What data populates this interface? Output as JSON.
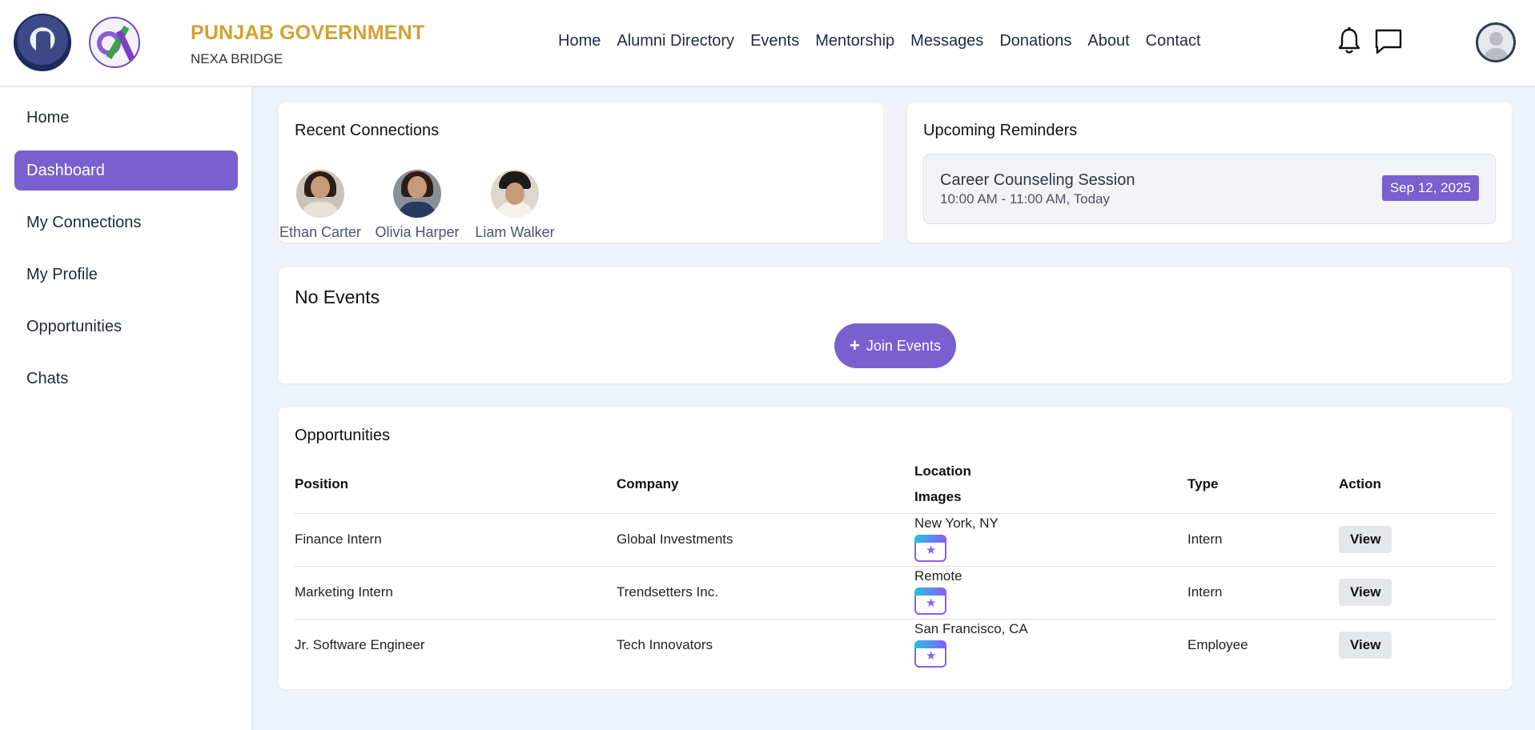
{
  "header": {
    "brand_title": "PUNJAB GOVERNMENT",
    "brand_subtitle": "NEXA BRIDGE",
    "nav": [
      "Home",
      "Alumni Directory",
      "Events",
      "Mentorship",
      "Messages",
      "Donations",
      "About",
      "Contact"
    ]
  },
  "sidebar": {
    "items": [
      {
        "label": "Home",
        "active": false
      },
      {
        "label": "Dashboard",
        "active": true
      },
      {
        "label": "My Connections",
        "active": false
      },
      {
        "label": "My Profile",
        "active": false
      },
      {
        "label": "Opportunities",
        "active": false
      },
      {
        "label": "Chats",
        "active": false
      }
    ]
  },
  "recent_connections": {
    "title": "Recent Connections",
    "people": [
      {
        "name": "Ethan Carter"
      },
      {
        "name": "Olivia Harper"
      },
      {
        "name": "Liam Walker"
      }
    ]
  },
  "reminders": {
    "title": "Upcoming Reminders",
    "item": {
      "title": "Career Counseling Session",
      "time": "10:00 AM - 11:00 AM, Today",
      "date": "Sep 12, 2025"
    }
  },
  "events": {
    "title": "No Events",
    "join_label": "Join Events"
  },
  "opportunities": {
    "title": "Opportunities",
    "columns": {
      "position": "Position",
      "company": "Company",
      "location": "Location",
      "images": "Images",
      "type": "Type",
      "action": "Action"
    },
    "rows": [
      {
        "position": "Finance Intern",
        "company": "Global Investments",
        "location": "New York, NY",
        "type": "Intern",
        "action": "View"
      },
      {
        "position": "Marketing Intern",
        "company": "Trendsetters Inc.",
        "location": "Remote",
        "type": "Intern",
        "action": "View"
      },
      {
        "position": "Jr. Software Engineer",
        "company": "Tech Innovators",
        "location": "San Francisco, CA",
        "type": "Employee",
        "action": "View"
      }
    ]
  },
  "colors": {
    "accent": "#7a5fcf",
    "brand_gold": "#d4a030",
    "background": "#eef3fb"
  }
}
